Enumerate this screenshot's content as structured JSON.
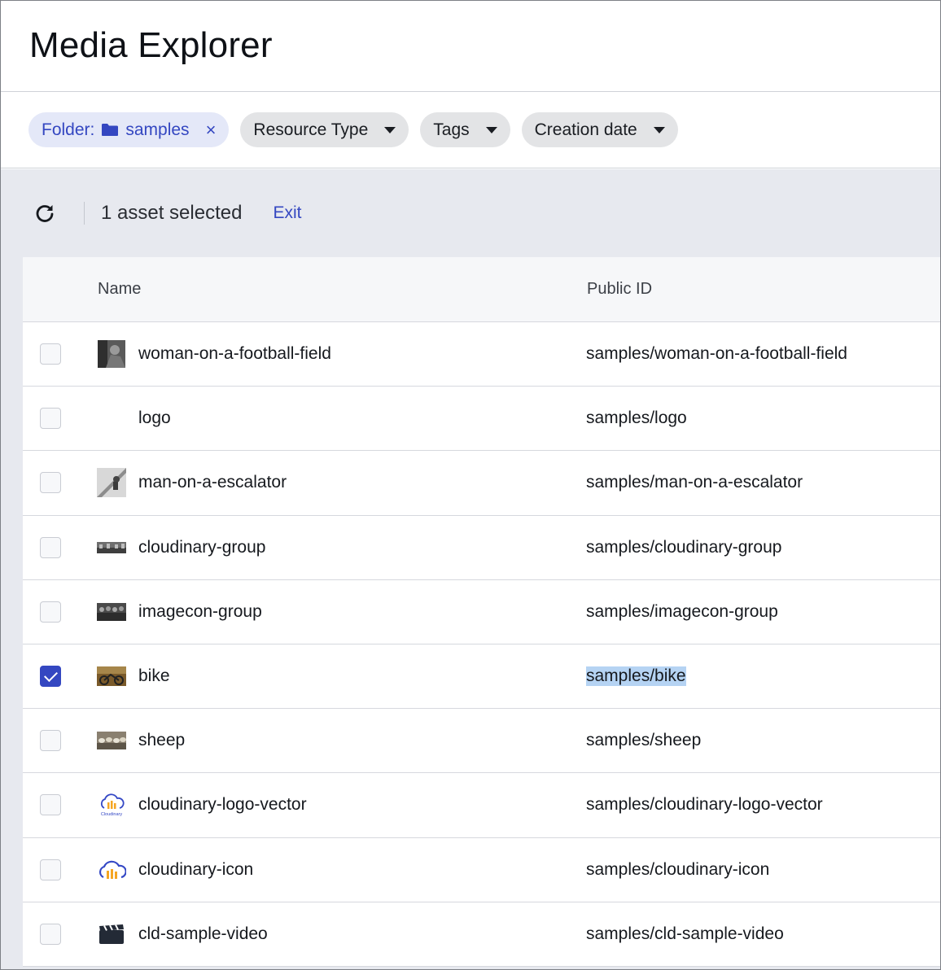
{
  "header": {
    "title": "Media Explorer"
  },
  "filters": {
    "folder_label": "Folder:",
    "folder_value": "samples",
    "close_symbol": "×",
    "resource_type": "Resource Type",
    "tags": "Tags",
    "creation_date": "Creation date"
  },
  "selection": {
    "count_text": "1 asset selected",
    "exit_label": "Exit"
  },
  "table": {
    "columns": {
      "name": "Name",
      "public_id": "Public ID"
    },
    "rows": [
      {
        "name": "woman-on-a-football-field",
        "public_id": "samples/woman-on-a-football-field",
        "checked": false,
        "thumb": "photo-portrait"
      },
      {
        "name": "logo",
        "public_id": "samples/logo",
        "checked": false,
        "thumb": "blank"
      },
      {
        "name": "man-on-a-escalator",
        "public_id": "samples/man-on-a-escalator",
        "checked": false,
        "thumb": "photo-escalator"
      },
      {
        "name": "cloudinary-group",
        "public_id": "samples/cloudinary-group",
        "checked": false,
        "thumb": "photo-group"
      },
      {
        "name": "imagecon-group",
        "public_id": "samples/imagecon-group",
        "checked": false,
        "thumb": "photo-group-dark"
      },
      {
        "name": "bike",
        "public_id": "samples/bike",
        "checked": true,
        "thumb": "photo-bike"
      },
      {
        "name": "sheep",
        "public_id": "samples/sheep",
        "checked": false,
        "thumb": "photo-sheep"
      },
      {
        "name": "cloudinary-logo-vector",
        "public_id": "samples/cloudinary-logo-vector",
        "checked": false,
        "thumb": "cloudinary-logo-icon"
      },
      {
        "name": "cloudinary-icon",
        "public_id": "samples/cloudinary-icon",
        "checked": false,
        "thumb": "cloudinary-cloud-icon"
      },
      {
        "name": "cld-sample-video",
        "public_id": "samples/cld-sample-video",
        "checked": false,
        "thumb": "video-clapper-icon"
      }
    ]
  },
  "colors": {
    "accent": "#3447c1",
    "highlight": "#b5d3f3",
    "toolbar_bg": "#e7e9ef"
  },
  "thumb_logo_text": "Cloudinary"
}
